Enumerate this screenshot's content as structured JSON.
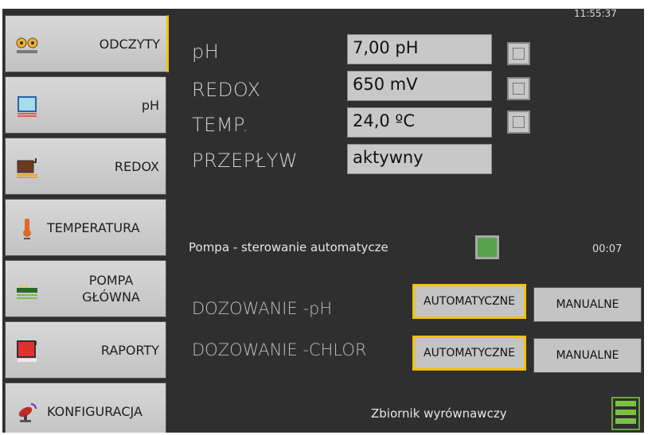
{
  "clock": "11:55:37",
  "nav": {
    "items": [
      {
        "label_lines": [
          "ODCZYTY"
        ],
        "icon": "eye-icon",
        "active": true
      },
      {
        "label_lines": [
          "pH"
        ],
        "icon": "beaker-icon"
      },
      {
        "label_lines": [
          "REDOX"
        ],
        "icon": "tank-icon"
      },
      {
        "label_lines": [
          "TEMPERATURA"
        ],
        "icon": "thermometer-icon"
      },
      {
        "label_lines": [
          "POMPA",
          "GŁÓWNA"
        ],
        "icon": "pump-icon"
      },
      {
        "label_lines": [
          "RAPORTY"
        ],
        "icon": "report-icon"
      },
      {
        "label_lines": [
          "KONFIGURACJA"
        ],
        "icon": "satellite-icon"
      }
    ]
  },
  "readings": [
    {
      "label": "pH",
      "value": "7,00 pH",
      "has_checkbox": true
    },
    {
      "label": "REDOX",
      "value": "650 mV",
      "has_checkbox": true
    },
    {
      "label": "TEMP.",
      "value": "24,0 ºC",
      "has_checkbox": true
    },
    {
      "label": "PRZEPŁYW",
      "value": "aktywny",
      "has_checkbox": false
    }
  ],
  "pump": {
    "label": "Pompa - sterowanie automatycze",
    "time": "00:07",
    "indicator_color": "#56a24a"
  },
  "dosing": [
    {
      "label": "DOZOWANIE -pH",
      "auto": "AUTOMATYCZNE",
      "manual": "MANUALNE",
      "selected": "auto"
    },
    {
      "label": "DOZOWANIE -CHLOR",
      "auto": "AUTOMATYCZNE",
      "manual": "MANUALNE",
      "selected": "auto"
    }
  ],
  "tank": {
    "label": "Zbiornik wyrównawczy"
  },
  "colors": {
    "accent": "#f2c300",
    "ok_green": "#56a24a",
    "background": "#2f2f2f"
  }
}
